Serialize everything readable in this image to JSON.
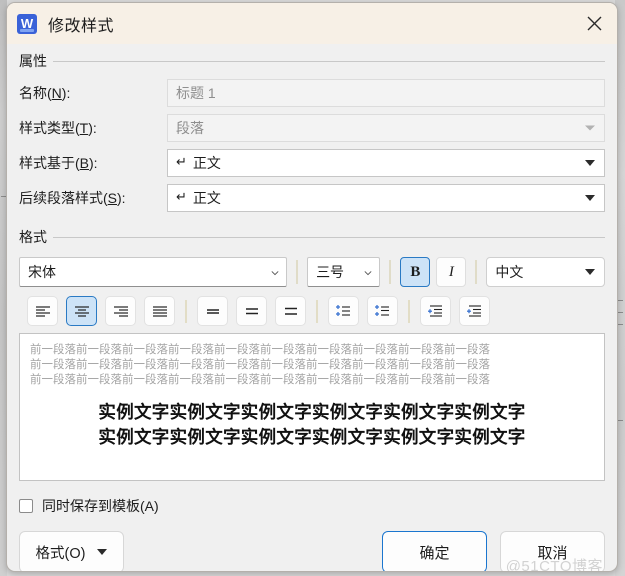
{
  "window": {
    "title": "修改样式",
    "app_icon": "word-w-icon",
    "close_icon": "close-icon",
    "titlebar_bg": "#f7f0e6",
    "accent": "#1b76cf"
  },
  "properties": {
    "group_label": "属性",
    "rows": [
      {
        "label_prefix": "名称(",
        "label_key": "N",
        "label_suffix": "):",
        "value": "标题 1",
        "disabled": true,
        "has_caret": false,
        "has_pilcrow": false
      },
      {
        "label_prefix": "样式类型(",
        "label_key": "T",
        "label_suffix": "):",
        "value": "段落",
        "disabled": true,
        "has_caret": true,
        "has_pilcrow": false
      },
      {
        "label_prefix": "样式基于(",
        "label_key": "B",
        "label_suffix": "):",
        "value": "正文",
        "disabled": false,
        "has_caret": true,
        "has_pilcrow": true
      },
      {
        "label_prefix": "后续段落样式(",
        "label_key": "S",
        "label_suffix": "):",
        "value": "正文",
        "disabled": false,
        "has_caret": true,
        "has_pilcrow": true
      }
    ],
    "pilcrow_glyph": "↵"
  },
  "format": {
    "group_label": "格式",
    "font_family": "宋体",
    "font_size": "三号",
    "bold_label": "B",
    "bold_active": true,
    "italic_label": "I",
    "italic_active": false,
    "language": "中文",
    "align_buttons": [
      {
        "name": "align-left-icon",
        "active": false
      },
      {
        "name": "align-center-icon",
        "active": true
      },
      {
        "name": "align-right-icon",
        "active": false
      },
      {
        "name": "align-justify-icon",
        "active": false
      }
    ],
    "line_spacing_buttons": [
      {
        "name": "line-spacing-single-icon",
        "active": false
      },
      {
        "name": "line-spacing-1-5-icon",
        "active": false
      },
      {
        "name": "line-spacing-double-icon",
        "active": false
      }
    ],
    "paragraph_spacing_buttons": [
      {
        "name": "increase-paragraph-spacing-icon",
        "active": false
      },
      {
        "name": "decrease-paragraph-spacing-icon",
        "active": false
      }
    ],
    "indent_buttons": [
      {
        "name": "decrease-indent-icon",
        "active": false
      },
      {
        "name": "increase-indent-icon",
        "active": false
      }
    ]
  },
  "preview": {
    "context_line_1": "前一段落前一段落前一段落前一段落前一段落前一段落前一段落前一段落前一段落前一段落",
    "context_line_2": "前一段落前一段落前一段落前一段落前一段落前一段落前一段落前一段落前一段落前一段落",
    "context_line_3": "前一段落前一段落前一段落前一段落前一段落前一段落前一段落前一段落前一段落前一段落",
    "sample_line_1": "实例文字实例文字实例文字实例文字实例文字实例文字",
    "sample_line_2": "实例文字实例文字实例文字实例文字实例文字实例文字"
  },
  "options": {
    "save_to_template_label": "同时保存到模板(A)",
    "save_to_template_checked": false
  },
  "footer": {
    "format_menu_label": "格式(O)",
    "ok_label": "确定",
    "cancel_label": "取消",
    "watermark": "@51CTO博客"
  }
}
